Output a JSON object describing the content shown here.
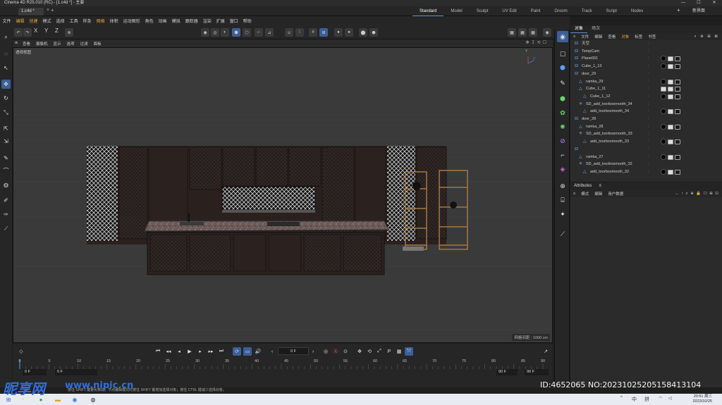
{
  "title_bar": {
    "title": "Cinema 4D R25.010 (RC) - [1.c4d *] - 主要",
    "minimize": "—",
    "maximize": "☐",
    "close": "✕"
  },
  "tabs": {
    "doc_tab": "1.c4d *",
    "close": "×",
    "add": "+",
    "layouts": [
      "Standard",
      "Model",
      "Sculpt",
      "UV Edit",
      "Paint",
      "Groom",
      "Track",
      "Script",
      "Nodes"
    ],
    "layout_add": "+",
    "new_layout": "新界面"
  },
  "main_menu": [
    "文件",
    "编辑",
    "创建",
    "模式",
    "选择",
    "工具",
    "样条",
    "网格",
    "体积",
    "运动图形",
    "角色",
    "动画",
    "模拟",
    "跟踪器",
    "渲染",
    "扩展",
    "窗口",
    "帮助"
  ],
  "toolbar": {
    "axes": [
      "X",
      "Y",
      "Z"
    ]
  },
  "viewport": {
    "menu": [
      "查看",
      "摄像机",
      "显示",
      "选项",
      "过滤",
      "面板"
    ],
    "label": "透视视图",
    "grid_spacing": "网格间距 : 1000 cm",
    "axis_y": "Y",
    "axis_z": "Z"
  },
  "timeline": {
    "current_frame": "0 F",
    "ruler_ticks": [
      "0",
      "5",
      "10",
      "15",
      "20",
      "25",
      "30",
      "35",
      "40",
      "45",
      "50",
      "55",
      "60",
      "65",
      "70",
      "75",
      "80",
      "85",
      "90"
    ],
    "range_start": "0 F",
    "range_start2": "0 F",
    "range_end": "90 F",
    "range_end2": "90 F",
    "marker": "0"
  },
  "status": {
    "text": "按住 SHIFT 键量化移动；节点编辑模式时按住 SHIFT 键增加选择对象；按住 CTRL 键减少选择对象。"
  },
  "object_manager": {
    "tabs": [
      "对象",
      "场次"
    ],
    "menu": [
      "文件",
      "编辑",
      "查看",
      "对象",
      "标签",
      "书签"
    ],
    "active_menu": "对象",
    "rows": [
      {
        "name": "天空",
        "indent": 0
      },
      {
        "name": "TempCam",
        "indent": 0
      },
      {
        "name": "Plane001",
        "indent": 0
      },
      {
        "name": "Cube_1_13",
        "indent": 0
      },
      {
        "name": "door_29",
        "indent": 0
      },
      {
        "name": "ramka_29",
        "indent": 1
      },
      {
        "name": "Cube_1_11",
        "indent": 1
      },
      {
        "name": "Cube_1_12",
        "indent": 2
      },
      {
        "name": "SD_add_toorbosmooth_34",
        "indent": 1
      },
      {
        "name": "add_toorbosmooth_34",
        "indent": 2
      },
      {
        "name": "door_28",
        "indent": 0
      },
      {
        "name": "ramka_28",
        "indent": 1
      },
      {
        "name": "SD_add_toorbosmooth_33",
        "indent": 1
      },
      {
        "name": "add_toorbosmooth_33",
        "indent": 2
      },
      {
        "name": "",
        "indent": 0
      },
      {
        "name": "ramka_27",
        "indent": 1
      },
      {
        "name": "SD_add_toorbosmooth_32",
        "indent": 1
      },
      {
        "name": "add_toorbosmooth_32",
        "indent": 2
      }
    ]
  },
  "attributes": {
    "tab": "Attributes",
    "menu": [
      "模式",
      "编辑",
      "用户数据"
    ],
    "nav": "← ↑ ⌕ ⊕ 🔒 ☐ ⊞ ⊡"
  },
  "taskbar": {
    "time": "20:51 周三",
    "date": "2023/10/25",
    "ime": "中",
    "ime2": "拼"
  },
  "watermark": {
    "logo": "昵享网",
    "url": "www.nipic.cn",
    "id": "ID:4652065 NO:20231025205158413104"
  }
}
